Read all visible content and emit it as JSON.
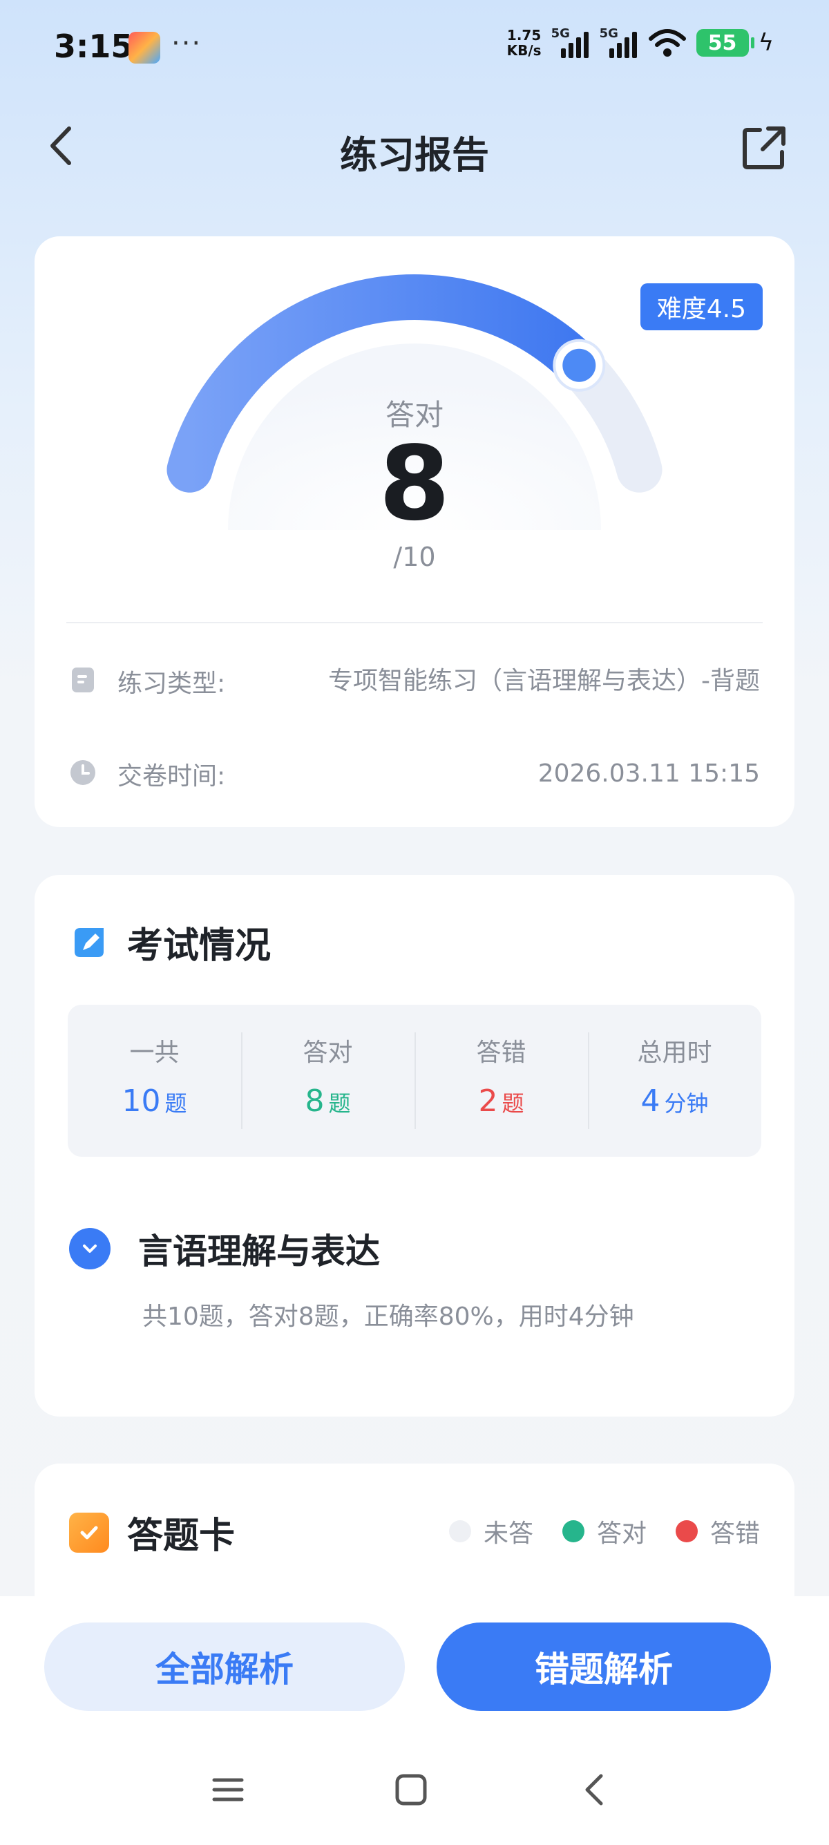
{
  "status_bar": {
    "time": "3:15",
    "dots": "···",
    "net_speed_value": "1.75",
    "net_speed_unit": "KB/s",
    "sim1_label": "5G",
    "sim2_label": "5G",
    "battery": "55"
  },
  "nav": {
    "title": "练习报告",
    "back_icon": "chevron-left-icon",
    "share_icon": "share-external-icon"
  },
  "score": {
    "difficulty": "难度4.5",
    "label": "答对",
    "value": "8",
    "total": "/10",
    "correct_fraction": 0.8
  },
  "info": {
    "type_label": "练习类型:",
    "type_value": "专项智能练习（言语理解与表达）-背题",
    "time_label": "交卷时间:",
    "time_value": "2026.03.11 15:15"
  },
  "exam": {
    "title": "考试情况",
    "stats": [
      {
        "label": "一共",
        "value": "10",
        "unit": "题"
      },
      {
        "label": "答对",
        "value": "8",
        "unit": "题"
      },
      {
        "label": "答错",
        "value": "2",
        "unit": "题"
      },
      {
        "label": "总用时",
        "value": "4",
        "unit": "分钟"
      }
    ],
    "topic_name": "言语理解与表达",
    "topic_summary": "共10题，答对8题，正确率80%，用时4分钟"
  },
  "answer_card": {
    "title": "答题卡",
    "legend": [
      {
        "label": "未答",
        "color": "#eef0f4"
      },
      {
        "label": "答对",
        "color": "#26b58c"
      },
      {
        "label": "答错",
        "color": "#ea4a4a"
      }
    ]
  },
  "buttons": {
    "all_analysis": "全部解析",
    "wrong_analysis": "错题解析"
  },
  "colors": {
    "accent": "#3a7bf5",
    "correct": "#26b58c",
    "wrong": "#ea4a4a"
  }
}
